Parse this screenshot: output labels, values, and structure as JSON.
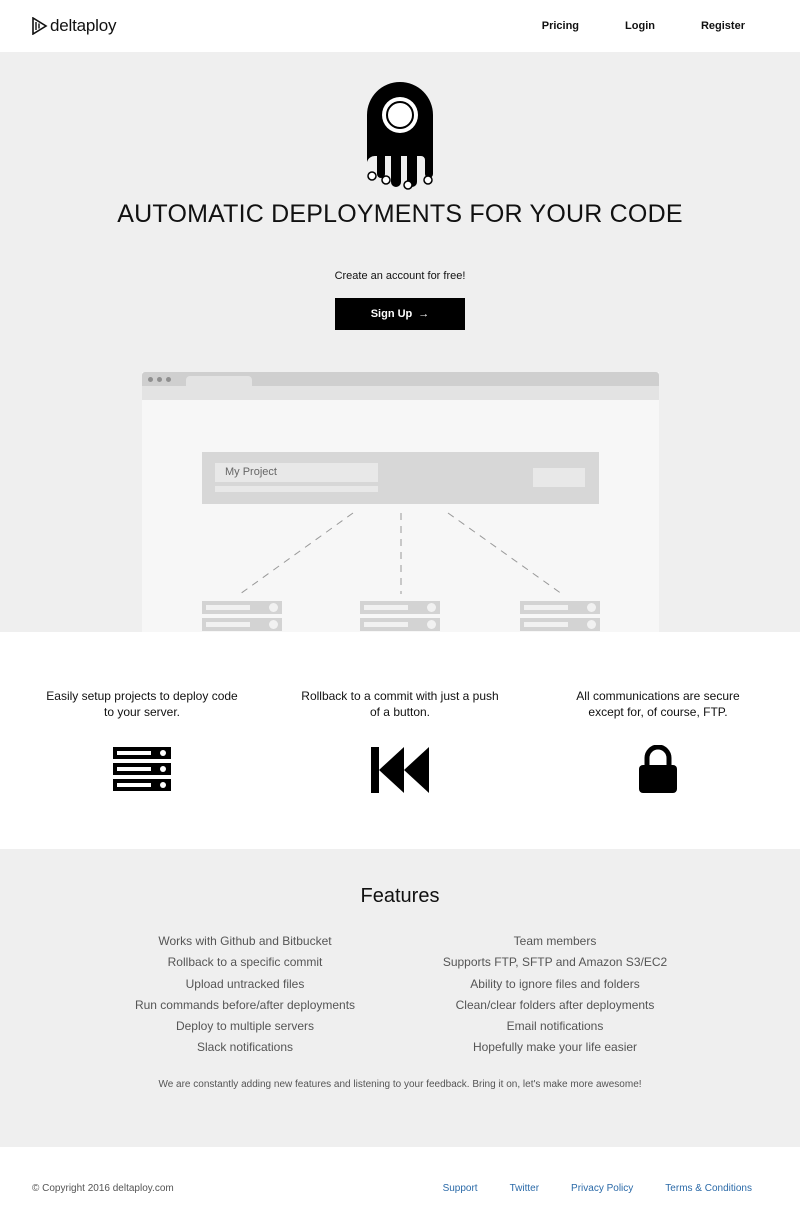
{
  "brand": {
    "name": "deltaploy"
  },
  "nav": {
    "pricing": "Pricing",
    "login": "Login",
    "register": "Register"
  },
  "hero": {
    "title": "AUTOMATIC DEPLOYMENTS FOR YOUR CODE",
    "subtitle": "Create an account for free!",
    "signup_label": "Sign Up",
    "signup_arrow": "→"
  },
  "mockup": {
    "project_name": "My Project"
  },
  "highlights": [
    {
      "text": "Easily setup projects to deploy code to your server.",
      "icon": "server-stack-icon"
    },
    {
      "text": "Rollback to a commit with just a push of a button.",
      "icon": "rewind-icon"
    },
    {
      "text": "All communications are secure except for, of course, FTP.",
      "icon": "lock-icon"
    }
  ],
  "features": {
    "title": "Features",
    "left": [
      "Works with Github and Bitbucket",
      "Rollback to a specific commit",
      "Upload untracked files",
      "Run commands before/after deployments",
      "Deploy to multiple servers",
      "Slack notifications"
    ],
    "right": [
      "Team members",
      "Supports FTP, SFTP and Amazon S3/EC2",
      "Ability to ignore files and folders",
      "Clean/clear folders after deployments",
      "Email notifications",
      "Hopefully make your life easier"
    ],
    "note": "We are constantly adding new features and listening to your feedback. Bring it on, let's make more awesome!"
  },
  "footer": {
    "copyright": "© Copyright 2016 deltaploy.com",
    "support": "Support",
    "twitter": "Twitter",
    "privacy": "Privacy Policy",
    "terms": "Terms & Conditions"
  }
}
